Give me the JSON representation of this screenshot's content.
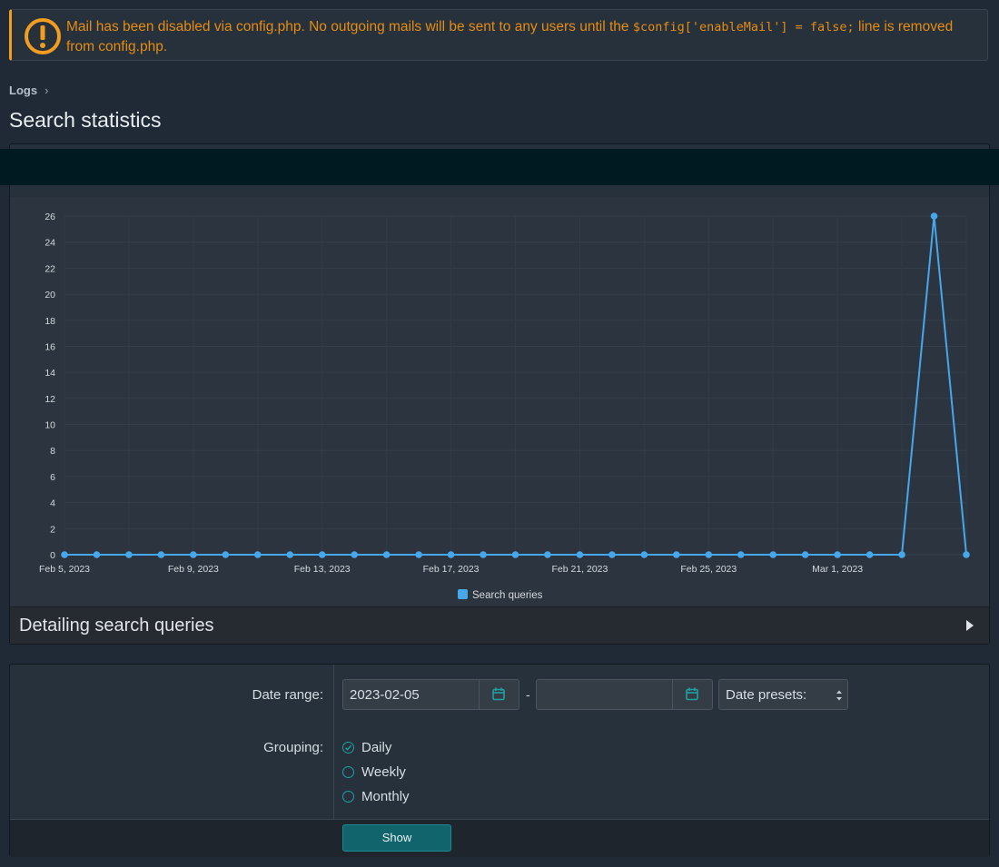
{
  "notice": {
    "text_before": "Mail has been disabled via config.php. No outgoing mails will be sent to any users until the ",
    "code": "$config['enableMail'] = false;",
    "text_after": " line is removed from config.php."
  },
  "breadcrumb": {
    "item": "Logs"
  },
  "page_title": "Search statistics",
  "chart_data": {
    "type": "line",
    "x": [
      "Feb 5, 2023",
      "Feb 6, 2023",
      "Feb 7, 2023",
      "Feb 8, 2023",
      "Feb 9, 2023",
      "Feb 10, 2023",
      "Feb 11, 2023",
      "Feb 12, 2023",
      "Feb 13, 2023",
      "Feb 14, 2023",
      "Feb 15, 2023",
      "Feb 16, 2023",
      "Feb 17, 2023",
      "Feb 18, 2023",
      "Feb 19, 2023",
      "Feb 20, 2023",
      "Feb 21, 2023",
      "Feb 22, 2023",
      "Feb 23, 2023",
      "Feb 24, 2023",
      "Feb 25, 2023",
      "Feb 26, 2023",
      "Feb 27, 2023",
      "Feb 28, 2023",
      "Mar 1, 2023",
      "Mar 2, 2023",
      "Mar 3, 2023",
      "Mar 4, 2023",
      "Mar 5, 2023"
    ],
    "x_tick_labels": [
      "Feb 5, 2023",
      "Feb 9, 2023",
      "Feb 13, 2023",
      "Feb 17, 2023",
      "Feb 21, 2023",
      "Feb 25, 2023",
      "Mar 1, 2023"
    ],
    "series": [
      {
        "name": "Search queries",
        "color": "#47a7eb",
        "values": [
          0,
          0,
          0,
          0,
          0,
          0,
          0,
          0,
          0,
          0,
          0,
          0,
          0,
          0,
          0,
          0,
          0,
          0,
          0,
          0,
          0,
          0,
          0,
          0,
          0,
          0,
          0,
          26,
          0
        ]
      }
    ],
    "y_ticks": [
      0,
      2,
      4,
      6,
      8,
      10,
      12,
      14,
      16,
      18,
      20,
      22,
      24,
      26
    ],
    "ylim": [
      0,
      26
    ],
    "grid": true,
    "legend": "bottom"
  },
  "detail": {
    "title": "Detailing search queries"
  },
  "form": {
    "date_range_label": "Date range:",
    "start_date": "2023-02-05",
    "end_date": "",
    "date_presets_label": "Date presets:",
    "dash": "-",
    "grouping_label": "Grouping:",
    "grouping_options": [
      {
        "label": "Daily",
        "checked": true
      },
      {
        "label": "Weekly",
        "checked": false
      },
      {
        "label": "Monthly",
        "checked": false
      }
    ],
    "show_button": "Show"
  },
  "colors": {
    "accent": "#21a0a0",
    "warning": "#e58c12",
    "series": "#47a7eb"
  }
}
